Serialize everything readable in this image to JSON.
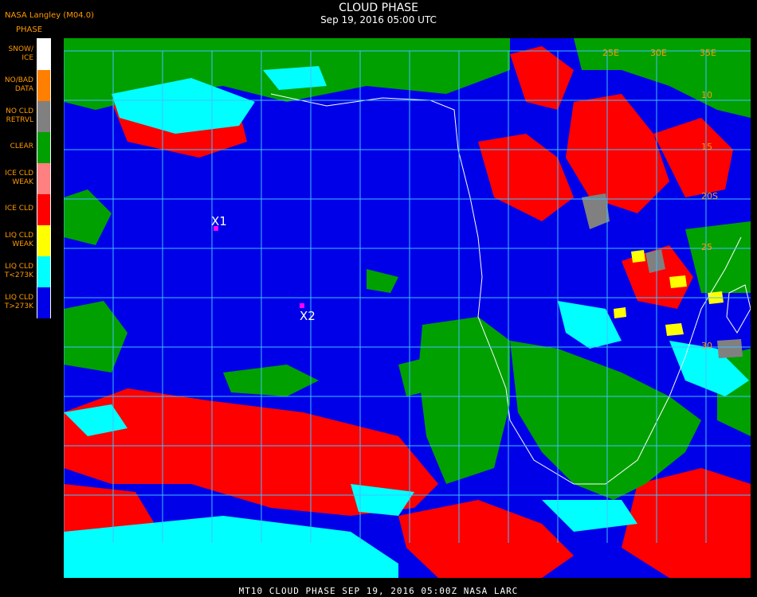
{
  "header": {
    "source": "NASA Langley (M04.0)",
    "title": "CLOUD PHASE",
    "subtitle": "Sep 19, 2016 05:00 UTC"
  },
  "legend": {
    "title": "PHASE",
    "items": [
      {
        "label": "SNOW/\nICE",
        "color": "#ffffff"
      },
      {
        "label": "NO/BAD\nDATA",
        "color": "#ff7f00"
      },
      {
        "label": "NO CLD\nRETRVL",
        "color": "#808080"
      },
      {
        "label": "CLEAR",
        "color": "#00a000"
      },
      {
        "label": "ICE CLD\nWEAK",
        "color": "#ff8080"
      },
      {
        "label": "ICE CLD",
        "color": "#ff0000"
      },
      {
        "label": "LIQ CLD\nWEAK",
        "color": "#ffff00"
      },
      {
        "label": "LIQ CLD\nT<273K",
        "color": "#00ffff"
      },
      {
        "label": "LIQ CLD\nT>273K",
        "color": "#0000e8"
      }
    ]
  },
  "map": {
    "grid_color": "#40c0ff",
    "coast_color": "#ffffff",
    "markers": [
      {
        "label": "X1"
      },
      {
        "label": "X2"
      }
    ],
    "lon_labels": [
      "25E",
      "30E",
      "35E"
    ],
    "lat_labels": [
      "10",
      "15",
      "20S",
      "25",
      "30"
    ]
  },
  "footer": {
    "text": "MT10   CLOUD PHASE   SEP 19, 2016 05:00Z   NASA LARC"
  }
}
